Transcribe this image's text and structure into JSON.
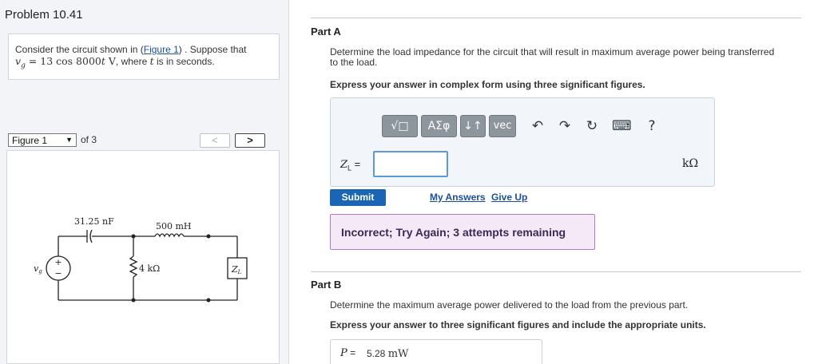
{
  "problem": {
    "title": "Problem 10.41",
    "text_before_link": "Consider the circuit shown in (",
    "link": "Figure 1",
    "text_after_link": ") . Suppose that",
    "eq_lhs": "v",
    "eq_sub": "g",
    "eq_rhs": " = 13 cos 8000",
    "eq_t": "t",
    "eq_unit": " V",
    "eq_tail": ", where ",
    "eq_t2": "t",
    "eq_end": " is in seconds."
  },
  "figure": {
    "select_label": "Figure 1",
    "of_label": "of 3",
    "prev_label": "<",
    "next_label": ">",
    "capacitor_label": "31.25 nF",
    "inductor_label": "500 mH",
    "resistor_label": "4 kΩ",
    "load_label": "Z",
    "load_sub": "L",
    "source_label": "v",
    "source_sub": "g"
  },
  "partA": {
    "title": "Part A",
    "question_line1": "Determine the load impedance for the circuit that will result in maximum average power being transferred",
    "question_line2": "to the load.",
    "instruction": "Express your answer in complex form using three significant figures.",
    "toolbar": {
      "templates": "√□",
      "greek": "AΣφ",
      "sort": "↓↑",
      "vec": "vec",
      "undo": "↶",
      "redo": "↷",
      "reset": "↻",
      "keyboard": "⌨",
      "help": "?"
    },
    "input_label": "Z",
    "input_sub": "L",
    "input_eq": " =",
    "input_value": "",
    "unit": "kΩ",
    "submit_label": "Submit",
    "my_answers_label": "My Answers",
    "give_up_label": "Give Up",
    "feedback": "Incorrect; Try Again; 3 attempts remaining"
  },
  "partB": {
    "title": "Part B",
    "question": "Determine the maximum average power delivered to the load from the previous part.",
    "instruction": "Express your answer to three significant figures and include the appropriate units.",
    "answer_label": "P",
    "answer_eq": " =",
    "answer_value": "5.28",
    "answer_unit": "mW"
  }
}
